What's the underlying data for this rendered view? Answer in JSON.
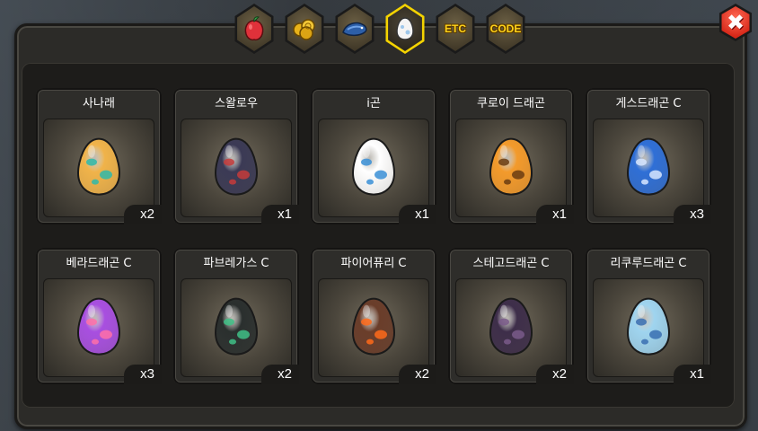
{
  "tabs": [
    {
      "id": "fruit",
      "icon": "red-fruit-icon"
    },
    {
      "id": "coins",
      "icon": "gold-coins-icon"
    },
    {
      "id": "fish",
      "icon": "blue-fish-icon"
    },
    {
      "id": "eggs",
      "icon": "egg-icon",
      "active": true
    },
    {
      "id": "etc",
      "label": "ETC"
    },
    {
      "id": "code",
      "label": "CODE"
    }
  ],
  "close_label": "✖",
  "eggs": [
    {
      "name": "사나래",
      "qty": "x2",
      "colors": [
        "#f0b34a",
        "#2fb9a9"
      ]
    },
    {
      "name": "스왈로우",
      "qty": "x1",
      "colors": [
        "#3b3a55",
        "#c53b3b"
      ]
    },
    {
      "name": "i곤",
      "qty": "x1",
      "colors": [
        "#ffffff",
        "#3a8fd6"
      ]
    },
    {
      "name": "쿠로이 드래곤",
      "qty": "x1",
      "colors": [
        "#f39a2b",
        "#6a3c12"
      ]
    },
    {
      "name": "게스드래곤 C",
      "qty": "x3",
      "colors": [
        "#2f6fd6",
        "#d7e6ff"
      ]
    },
    {
      "name": "베라드래곤 C",
      "qty": "x3",
      "colors": [
        "#a84fe0",
        "#ff6fa8"
      ]
    },
    {
      "name": "파브레가스 C",
      "qty": "x2",
      "colors": [
        "#2a2f2e",
        "#3fbf86"
      ]
    },
    {
      "name": "파이어퓨리 C",
      "qty": "x2",
      "colors": [
        "#6a3d2a",
        "#ff6a1a"
      ]
    },
    {
      "name": "스테고드래곤 C",
      "qty": "x2",
      "colors": [
        "#3e2e4a",
        "#7a5a8a"
      ]
    },
    {
      "name": "리쿠루드래곤 C",
      "qty": "x1",
      "colors": [
        "#9fd4ef",
        "#3a6fb2"
      ]
    }
  ]
}
